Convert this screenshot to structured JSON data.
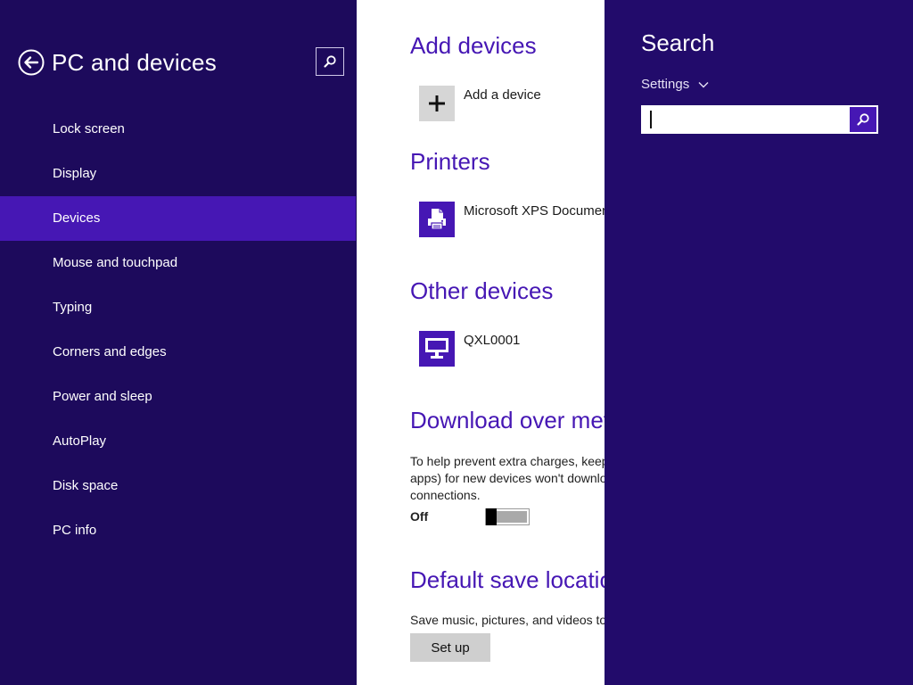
{
  "nav": {
    "title": "PC and devices",
    "back_icon": "back-arrow-icon",
    "search_icon": "search-icon",
    "items": [
      {
        "label": "Lock screen",
        "selected": false
      },
      {
        "label": "Display",
        "selected": false
      },
      {
        "label": "Devices",
        "selected": true
      },
      {
        "label": "Mouse and touchpad",
        "selected": false
      },
      {
        "label": "Typing",
        "selected": false
      },
      {
        "label": "Corners and edges",
        "selected": false
      },
      {
        "label": "Power and sleep",
        "selected": false
      },
      {
        "label": "AutoPlay",
        "selected": false
      },
      {
        "label": "Disk space",
        "selected": false
      },
      {
        "label": "PC info",
        "selected": false
      }
    ]
  },
  "content": {
    "add_devices": {
      "title": "Add devices",
      "add_label": "Add a device",
      "icon": "plus-icon"
    },
    "printers": {
      "title": "Printers",
      "device_label": "Microsoft XPS Document Writer",
      "icon": "printer-icon"
    },
    "other_devices": {
      "title": "Other devices",
      "device_label": "QXL0001",
      "icon": "monitor-icon"
    },
    "download_metered": {
      "title": "Download over metered connections",
      "description": "To help prevent extra charges, keep this off so device software (drivers, info, and apps) for new devices won't download while you're on metered Internet connections.",
      "toggle_label": "Off",
      "toggle_on": false
    },
    "default_save": {
      "title": "Default save location",
      "description": "Save music, pictures, and videos to",
      "button_label": "Set up"
    }
  },
  "search_charm": {
    "title": "Search",
    "scope": "Settings",
    "input_value": "",
    "go_icon": "search-icon"
  },
  "colors": {
    "nav_bg": "#1d0a5c",
    "accent": "#4617b4",
    "charm_bg": "#220b6b"
  }
}
